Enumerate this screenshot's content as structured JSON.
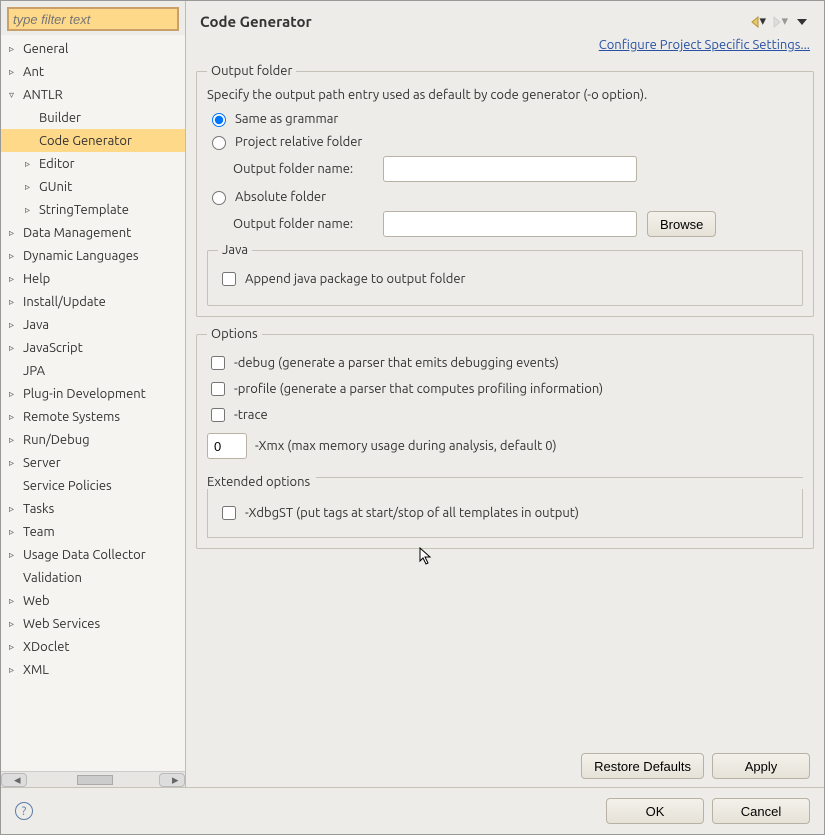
{
  "filter": {
    "placeholder": "type filter text"
  },
  "tree": [
    {
      "label": "General",
      "level": 1,
      "arrow": "▹"
    },
    {
      "label": "Ant",
      "level": 1,
      "arrow": "▹"
    },
    {
      "label": "ANTLR",
      "level": 1,
      "arrow": "▿"
    },
    {
      "label": "Builder",
      "level": 2,
      "arrow": ""
    },
    {
      "label": "Code Generator",
      "level": 2,
      "arrow": "",
      "selected": true
    },
    {
      "label": "Editor",
      "level": 2,
      "arrow": "▹"
    },
    {
      "label": "GUnit",
      "level": 2,
      "arrow": "▹"
    },
    {
      "label": "StringTemplate",
      "level": 2,
      "arrow": "▹"
    },
    {
      "label": "Data Management",
      "level": 1,
      "arrow": "▹"
    },
    {
      "label": "Dynamic Languages",
      "level": 1,
      "arrow": "▹"
    },
    {
      "label": "Help",
      "level": 1,
      "arrow": "▹"
    },
    {
      "label": "Install/Update",
      "level": 1,
      "arrow": "▹"
    },
    {
      "label": "Java",
      "level": 1,
      "arrow": "▹"
    },
    {
      "label": "JavaScript",
      "level": 1,
      "arrow": "▹"
    },
    {
      "label": "JPA",
      "level": 1,
      "arrow": ""
    },
    {
      "label": "Plug-in Development",
      "level": 1,
      "arrow": "▹"
    },
    {
      "label": "Remote Systems",
      "level": 1,
      "arrow": "▹"
    },
    {
      "label": "Run/Debug",
      "level": 1,
      "arrow": "▹"
    },
    {
      "label": "Server",
      "level": 1,
      "arrow": "▹"
    },
    {
      "label": "Service Policies",
      "level": 1,
      "arrow": ""
    },
    {
      "label": "Tasks",
      "level": 1,
      "arrow": "▹"
    },
    {
      "label": "Team",
      "level": 1,
      "arrow": "▹"
    },
    {
      "label": "Usage Data Collector",
      "level": 1,
      "arrow": "▹"
    },
    {
      "label": "Validation",
      "level": 1,
      "arrow": ""
    },
    {
      "label": "Web",
      "level": 1,
      "arrow": "▹"
    },
    {
      "label": "Web Services",
      "level": 1,
      "arrow": "▹"
    },
    {
      "label": "XDoclet",
      "level": 1,
      "arrow": "▹"
    },
    {
      "label": "XML",
      "level": 1,
      "arrow": "▹"
    }
  ],
  "header": {
    "title": "Code Generator",
    "link": "Configure Project Specific Settings..."
  },
  "output": {
    "legend": "Output folder",
    "desc": "Specify the output path entry used as default by code generator (-o option).",
    "radio_same": "Same as grammar",
    "radio_rel": "Project relative folder",
    "radio_abs": "Absolute folder",
    "folder_label": "Output folder name:",
    "rel_value": "",
    "abs_value": "",
    "browse": "Browse",
    "java_legend": "Java",
    "java_append": "Append java package to output folder"
  },
  "options": {
    "legend": "Options",
    "debug": "-debug (generate a parser that emits debugging events)",
    "profile": "-profile (generate a parser that computes profiling information)",
    "trace": "-trace",
    "xmx_value": "0",
    "xmx_label": "-Xmx (max memory usage during analysis, default 0)",
    "ext_legend": "Extended options",
    "xdbgst": "-XdbgST (put tags at start/stop of all templates in output)"
  },
  "buttons": {
    "restore": "Restore Defaults",
    "apply": "Apply",
    "ok": "OK",
    "cancel": "Cancel"
  }
}
